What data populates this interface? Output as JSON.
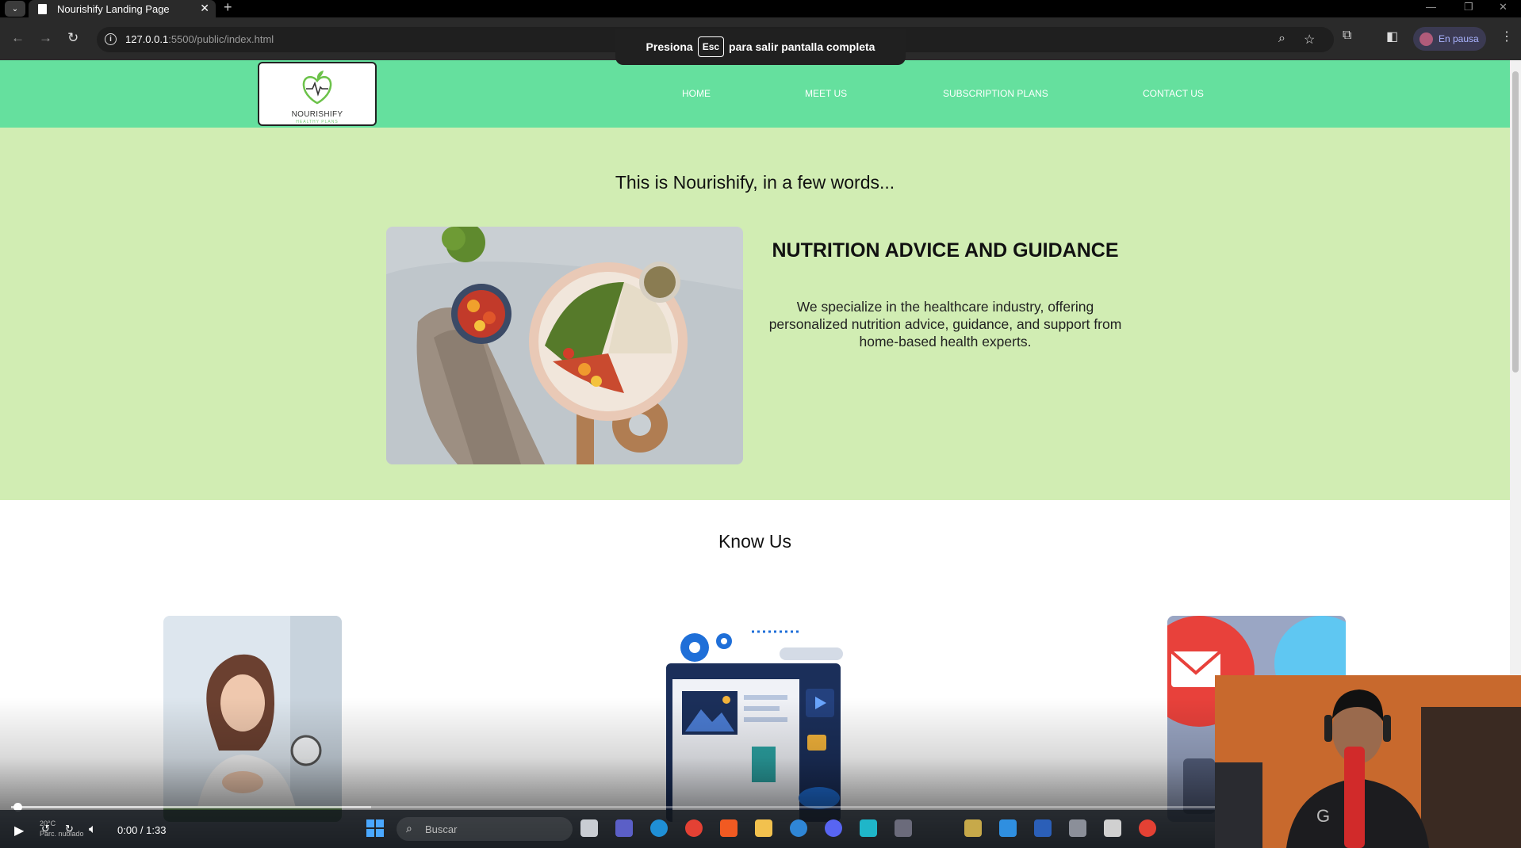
{
  "browser": {
    "tab_title": "Nourishify Landing Page",
    "url_host": "127.0.0.1",
    "url_path": ":5500/public/index.html",
    "profile_label": "En pausa",
    "fullscreen_notice": {
      "before": "Presiona",
      "key": "Esc",
      "after": "para salir pantalla completa"
    }
  },
  "site": {
    "logo_text": "NOURISHIFY",
    "logo_subtext": "HEALTHY PLANS",
    "nav": [
      "HOME",
      "MEET US",
      "SUBSCRIPTION PLANS",
      "CONTACT US"
    ],
    "intro_title": "This is Nourishify, in a few words...",
    "feature_heading": "NUTRITION ADVICE AND GUIDANCE",
    "feature_text": "We specialize in the healthcare industry, offering personalized nutrition advice, guidance, and support from home-based health experts.",
    "know_title": "Know Us",
    "colors": {
      "header": "#65e09e",
      "intro_bg": "#d1edb3"
    }
  },
  "player": {
    "time": "0:00 / 1:33",
    "progress_fraction": 0.0,
    "buffered_fraction": 0.24,
    "speed": "1x"
  },
  "taskbar": {
    "search_placeholder": "Buscar",
    "weather_temp": "20°C",
    "weather_desc": "Parc. nublado"
  }
}
